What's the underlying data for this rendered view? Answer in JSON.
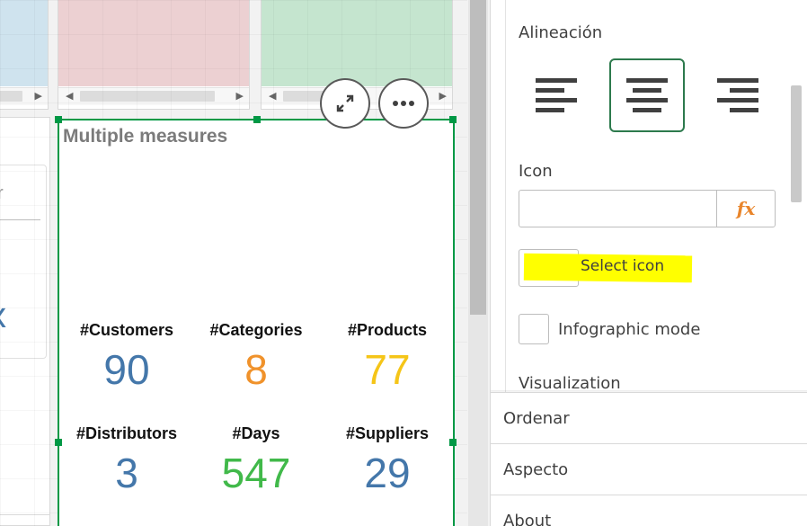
{
  "sheet": {
    "object_title": "Multiple measures",
    "search_placeholder_fragment": "r",
    "left_card_glyph": "x",
    "kpis": [
      {
        "label": "#Customers",
        "value": "90",
        "color": "#4477aa"
      },
      {
        "label": "#Categories",
        "value": "8",
        "color": "#f0922b"
      },
      {
        "label": "#Products",
        "value": "77",
        "color": "#f5c518"
      },
      {
        "label": "#Distributors",
        "value": "3",
        "color": "#4477aa"
      },
      {
        "label": "#Days",
        "value": "547",
        "color": "#41b94a"
      },
      {
        "label": "#Suppliers",
        "value": "29",
        "color": "#4477aa"
      }
    ],
    "thumbnail_colors": [
      "#cfe3ee",
      "#ecd0d2",
      "#c5e5cf"
    ],
    "accent_color": "#009845",
    "buttons": {
      "expand_icon": "expand-arrows-icon",
      "more_icon": "more-horizontal-icon"
    }
  },
  "properties": {
    "alignment": {
      "label": "Alineación",
      "options": [
        "left",
        "center",
        "right"
      ],
      "selected": "center"
    },
    "icon": {
      "label": "Icon",
      "value": "",
      "expression_button": "fx",
      "select_button_label": "Select icon"
    },
    "infographic_mode": {
      "label": "Infographic mode",
      "checked": false
    },
    "visualization_label": "Visualization",
    "accordion": [
      "Ordenar",
      "Aspecto",
      "About"
    ]
  }
}
